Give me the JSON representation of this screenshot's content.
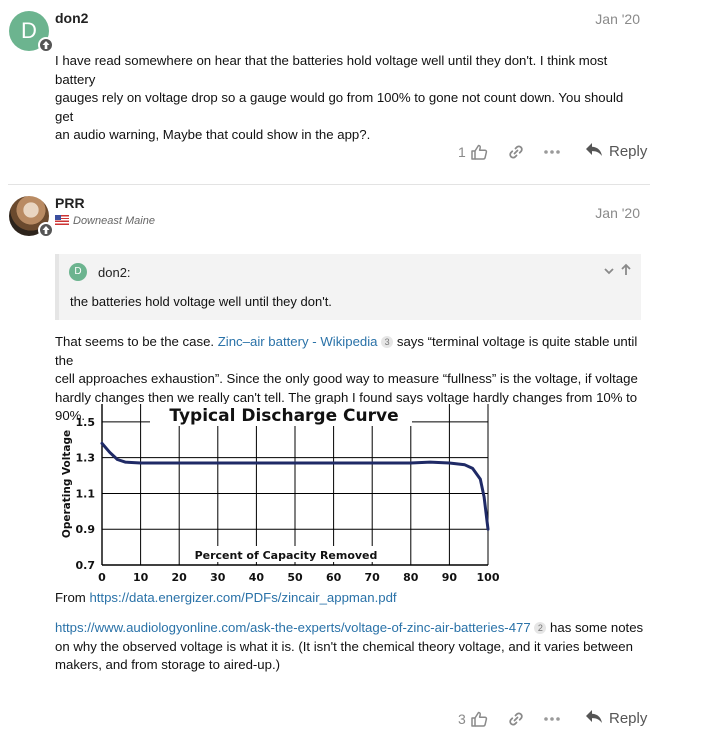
{
  "post1": {
    "avatar_letter": "D",
    "username": "don2",
    "date": "Jan '20",
    "body_lines": [
      "I have read somewhere on hear that the batteries hold voltage well until they don't. I think most battery",
      "gauges rely on voltage drop so a gauge would go from 100% to gone not count down. You should get",
      "an audio warning, Maybe that could show in the app?."
    ],
    "like_count": "1",
    "reply_label": "Reply"
  },
  "post2": {
    "username": "PRR",
    "flair": "Downeast Maine",
    "date": "Jan '20",
    "quote": {
      "avatar_letter": "D",
      "author": "don2:",
      "text": "the batteries hold voltage well until they don't."
    },
    "p1": {
      "before": "That seems to be the case. ",
      "link_text": "Zinc–air battery - Wikipedia",
      "link_count": "3",
      "after_line1": " says “terminal voltage is quite stable until the",
      "line2": "cell approaches exhaustion”. Since the only good way to measure “fullness” is the voltage, if voltage",
      "line3": "hardly changes then we really can't tell. The graph I found says voltage hardly changes from 10% to",
      "line4": "90%."
    },
    "from_label": "From ",
    "from_link": "https://data.energizer.com/PDFs/zincair_appman.pdf",
    "p3": {
      "link_text": "https://www.audiologyonline.com/ask-the-experts/voltage-of-zinc-air-batteries-477",
      "link_count": "2",
      "after_line1": " has some notes",
      "line2": "on why the observed voltage is what it is. (It isn't the chemical theory voltage, and it varies between",
      "line3": "makers, and from storage to aired-up.)"
    },
    "like_count": "3",
    "reply_label": "Reply"
  },
  "colors": {
    "avatar_green": "#6cb48f",
    "link_blue": "#2a72a8",
    "curve_navy": "#1f2a66"
  },
  "icons": [
    "thumbs-up-icon",
    "link-icon",
    "more-icon",
    "reply-icon",
    "chevron-down-icon",
    "arrow-up-icon"
  ],
  "chart_data": {
    "type": "line",
    "title": "Typical Discharge Curve",
    "xlabel": "Percent of Capacity Removed",
    "ylabel": "Operating Voltage",
    "xlim": [
      0,
      100
    ],
    "ylim": [
      0.7,
      1.6
    ],
    "x_ticks": [
      "0",
      "10",
      "20",
      "30",
      "40",
      "50",
      "60",
      "70",
      "80",
      "90",
      "100"
    ],
    "y_ticks": [
      "1.5",
      "1.3",
      "1.1",
      "0.9",
      "0.7"
    ],
    "grid": true,
    "series": [
      {
        "x": [
          0,
          2,
          4,
          6,
          10,
          20,
          40,
          60,
          80,
          85,
          90,
          94,
          96,
          98,
          99,
          100
        ],
        "y": [
          1.38,
          1.33,
          1.29,
          1.275,
          1.27,
          1.27,
          1.27,
          1.27,
          1.27,
          1.275,
          1.27,
          1.26,
          1.24,
          1.18,
          1.08,
          0.9
        ]
      }
    ]
  }
}
